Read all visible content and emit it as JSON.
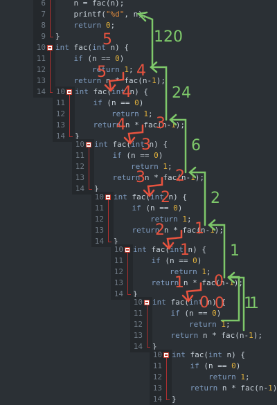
{
  "top_block": {
    "lines": [
      {
        "n": "6",
        "tokens": [
          [
            "    n = fac(n);",
            "tx"
          ]
        ]
      },
      {
        "n": "7",
        "tokens": [
          [
            "    printf(",
            "tx"
          ],
          [
            "\"%d\"",
            "str"
          ],
          [
            ", n);",
            "tx"
          ]
        ]
      },
      {
        "n": "8",
        "tokens": [
          [
            "    return ",
            "kw"
          ],
          [
            "0",
            "num"
          ],
          [
            ";",
            "tx"
          ]
        ]
      },
      {
        "n": "9",
        "tokens": [
          [
            "}",
            "tx"
          ]
        ]
      },
      {
        "n": "10",
        "tokens": [
          [
            "int ",
            "kw"
          ],
          [
            "fac(",
            "tx"
          ],
          [
            "int ",
            "kw"
          ],
          [
            "n) {",
            "tx"
          ]
        ]
      },
      {
        "n": "11",
        "tokens": [
          [
            "    if ",
            "kw"
          ],
          [
            "(n == ",
            "tx"
          ],
          [
            "0",
            "num"
          ],
          [
            ")",
            "tx"
          ]
        ]
      },
      {
        "n": "12",
        "tokens": [
          [
            "        return ",
            "kw"
          ],
          [
            "1",
            "num"
          ],
          [
            ";",
            "tx"
          ]
        ]
      },
      {
        "n": "13",
        "tokens": [
          [
            "    return ",
            "kw"
          ],
          [
            "n * fac(n-",
            "tx"
          ],
          [
            "1",
            "num"
          ],
          [
            ");",
            "tx"
          ]
        ]
      },
      {
        "n": "14",
        "tokens": [
          [
            "}",
            "tx"
          ]
        ]
      }
    ]
  },
  "fac_block": [
    {
      "n": "10",
      "tokens": [
        [
          "int ",
          "kw"
        ],
        [
          "fac(",
          "tx"
        ],
        [
          "int ",
          "kw"
        ],
        [
          "n) {",
          "tx"
        ]
      ]
    },
    {
      "n": "11",
      "tokens": [
        [
          "    if ",
          "kw"
        ],
        [
          "(n == ",
          "tx"
        ],
        [
          "0",
          "num"
        ],
        [
          ")",
          "tx"
        ]
      ]
    },
    {
      "n": "12",
      "tokens": [
        [
          "        return ",
          "kw"
        ],
        [
          "1",
          "num"
        ],
        [
          ";",
          "tx"
        ]
      ]
    },
    {
      "n": "13",
      "tokens": [
        [
          "    return ",
          "kw"
        ],
        [
          "n * fac(n-",
          "tx"
        ],
        [
          "1",
          "num"
        ],
        [
          ");",
          "tx"
        ]
      ]
    },
    {
      "n": "14",
      "tokens": [
        [
          "}",
          "tx"
        ]
      ]
    }
  ],
  "annotations": {
    "param_values": [
      "5",
      "4",
      "3",
      "2",
      "1",
      "0"
    ],
    "arg_values": [
      "4",
      "3",
      "2",
      "1",
      "0"
    ],
    "return_values": [
      "120",
      "24",
      "6",
      "2",
      "1",
      "1"
    ],
    "colors": {
      "red": "#e8533f",
      "green": "#7ec86a"
    }
  }
}
